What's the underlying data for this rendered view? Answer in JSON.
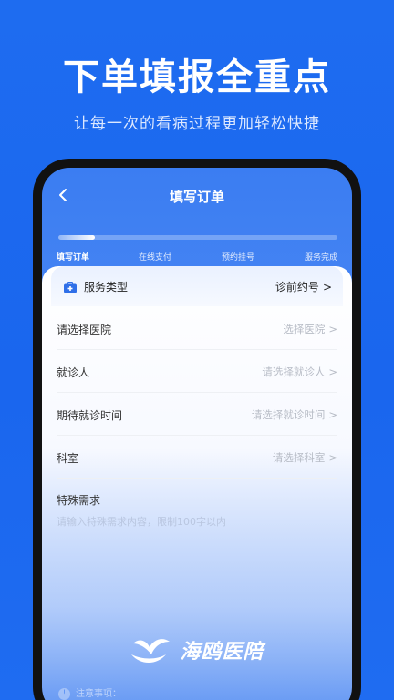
{
  "promo": {
    "headline": "下单填报全重点",
    "subline": "让每一次的看病过程更加轻松快捷"
  },
  "app": {
    "nav": {
      "title": "填写订单",
      "back_icon": "chevron-left-icon"
    },
    "progress": {
      "fraction": 0.13
    },
    "steps": [
      "填写订单",
      "在线支付",
      "预约挂号",
      "服务完成"
    ],
    "active_step": 0,
    "service": {
      "icon": "medical-kit-icon",
      "label": "服务类型",
      "value": "诊前约号"
    },
    "rows": [
      {
        "label": "请选择医院",
        "value": "选择医院"
      },
      {
        "label": "就诊人",
        "value": "请选择就诊人"
      },
      {
        "label": "期待就诊时间",
        "value": "请选择就诊时间"
      },
      {
        "label": "科室",
        "value": "请选择科室"
      }
    ],
    "special": {
      "label": "特殊需求",
      "placeholder": "请输入特殊需求内容，限制100字以内"
    },
    "notice": {
      "label": "注意事项："
    }
  },
  "brand": {
    "name": "海鸥医陪",
    "logo_icon": "seagull-logo-icon"
  },
  "colors": {
    "background": "#1e6cf0",
    "screen_top": "#3b7df2",
    "card": "#ffffff"
  }
}
